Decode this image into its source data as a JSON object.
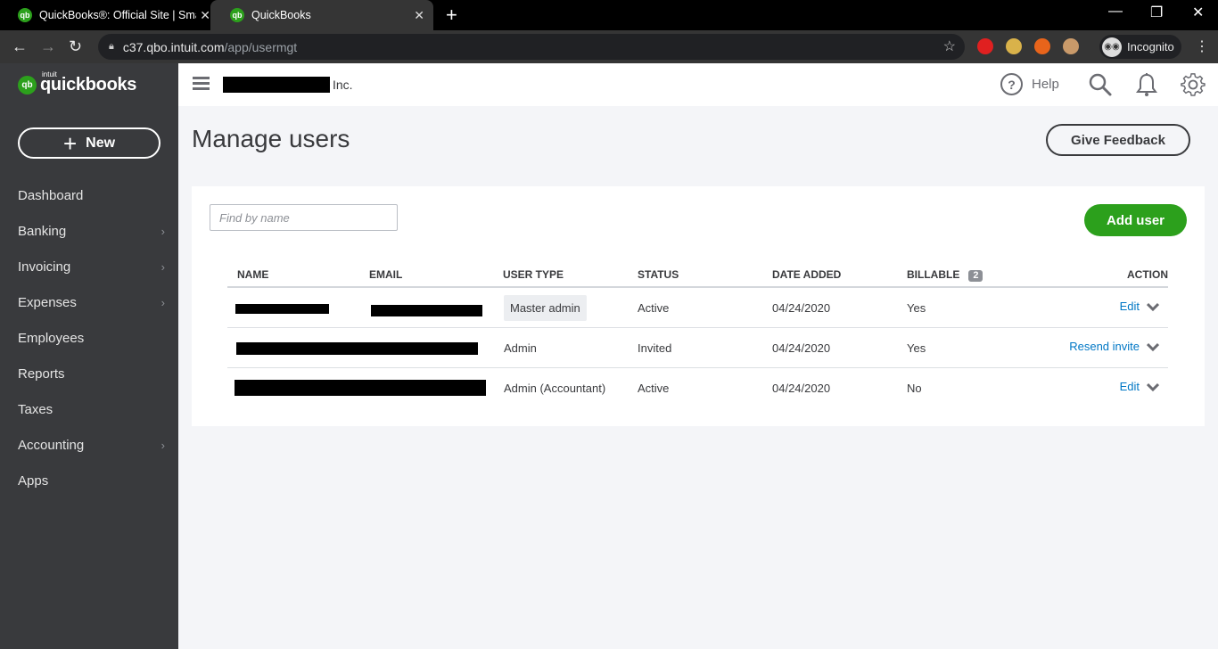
{
  "browser": {
    "tabs": [
      {
        "title": "QuickBooks®: Official Site | Smar",
        "favicon": "qb-icon",
        "active": false
      },
      {
        "title": "QuickBooks",
        "favicon": "qb-icon",
        "active": true
      }
    ],
    "url_host": "c37.qbo.intuit.com",
    "url_path": "/app/usermgt",
    "profile_label": "Incognito"
  },
  "sidebar": {
    "logo_intuit": "intuit",
    "logo_text": "quickbooks",
    "new_label": "New",
    "items": [
      {
        "label": "Dashboard",
        "has_submenu": false
      },
      {
        "label": "Banking",
        "has_submenu": true
      },
      {
        "label": "Invoicing",
        "has_submenu": true
      },
      {
        "label": "Expenses",
        "has_submenu": true
      },
      {
        "label": "Employees",
        "has_submenu": false
      },
      {
        "label": "Reports",
        "has_submenu": false
      },
      {
        "label": "Taxes",
        "has_submenu": false
      },
      {
        "label": "Accounting",
        "has_submenu": true
      },
      {
        "label": "Apps",
        "has_submenu": false
      }
    ]
  },
  "header": {
    "company_suffix": "Inc.",
    "help_label": "Help"
  },
  "main": {
    "title": "Manage users",
    "feedback_label": "Give Feedback",
    "search_placeholder": "Find by name",
    "add_user_label": "Add user",
    "columns": {
      "name": "NAME",
      "email": "EMAIL",
      "user_type": "USER TYPE",
      "status": "STATUS",
      "date_added": "DATE ADDED",
      "billable": "BILLABLE",
      "billable_count": "2",
      "action": "ACTION"
    },
    "rows": [
      {
        "user_type": "Master admin",
        "status": "Active",
        "date_added": "04/24/2020",
        "billable": "Yes",
        "action": "Edit"
      },
      {
        "user_type": "Admin",
        "status": "Invited",
        "date_added": "04/24/2020",
        "billable": "Yes",
        "action": "Resend invite"
      },
      {
        "user_type": "Admin (Accountant)",
        "status": "Active",
        "date_added": "04/24/2020",
        "billable": "No",
        "action": "Edit"
      }
    ]
  }
}
